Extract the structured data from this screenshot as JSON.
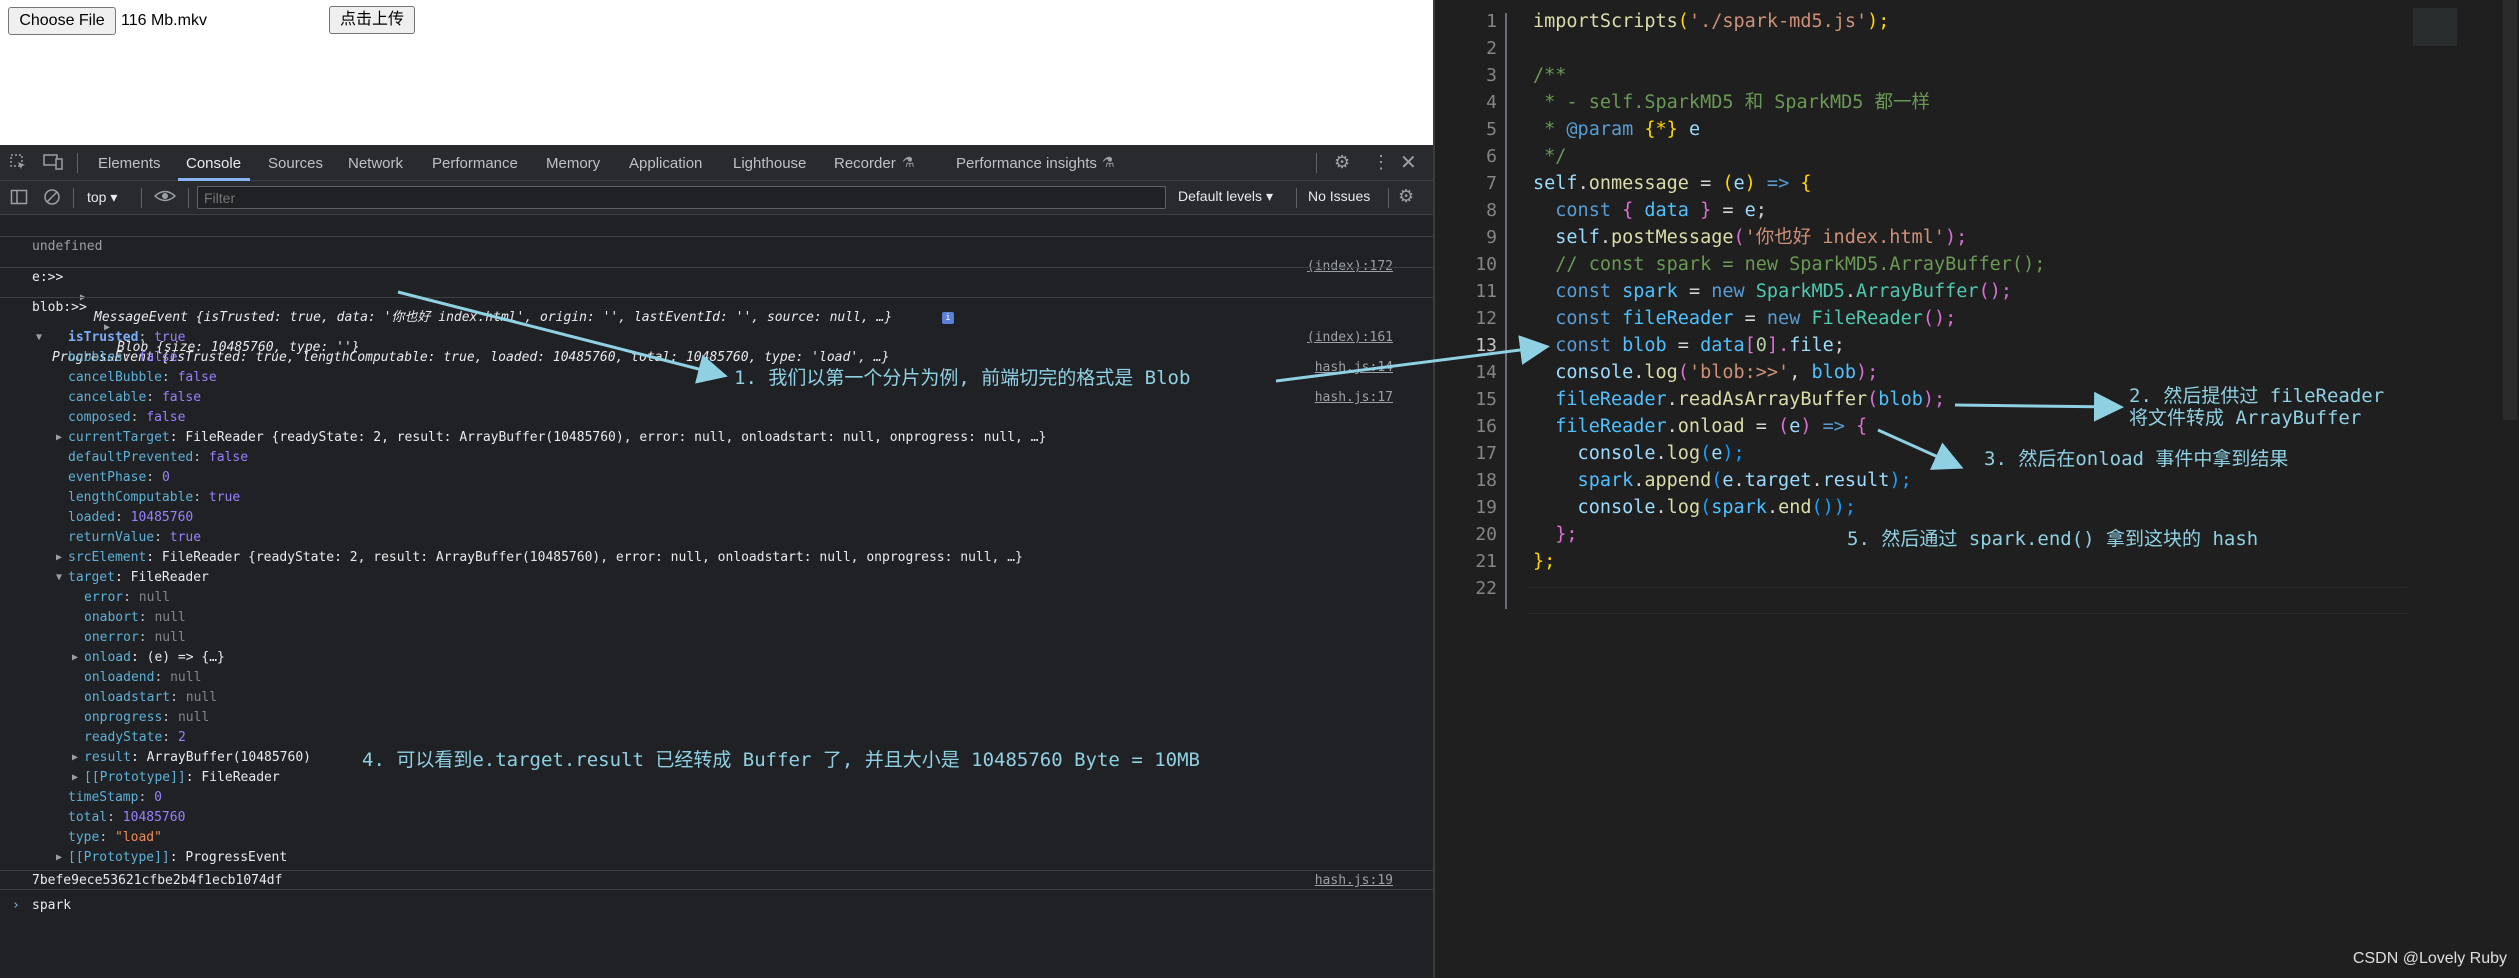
{
  "page": {
    "choose_file_label": "Choose File",
    "file_name": "116 Mb.mkv",
    "upload_label": "点击上传"
  },
  "devtools": {
    "tabs": [
      "Elements",
      "Console",
      "Sources",
      "Network",
      "Performance",
      "Memory",
      "Application",
      "Lighthouse",
      "Recorder",
      "Performance insights"
    ],
    "active_tab": "Console",
    "context": "top",
    "filter_placeholder": "Filter",
    "levels": "Default levels",
    "issues": "No Issues",
    "icons": [
      "inspect-icon",
      "device-icon",
      "gear-icon",
      "more-icon",
      "close-icon",
      "sidebar-icon",
      "clear-icon",
      "eye-icon"
    ]
  },
  "console": {
    "undefined": "undefined",
    "src_index172": "(index):172",
    "src_index161": "(index):161",
    "src_hash14": "hash.js:14",
    "src_hash17": "hash.js:17",
    "src_hash19": "hash.js:19",
    "e_prefix": "e:>> ",
    "e_obj": "MessageEvent {isTrusted: true, data: '你也好 index.html', origin: '', lastEventId: '', source: null, …}",
    "blob_prefix": "blob:>> ",
    "blob_obj": "Blob {size: 10485760, type: ''}",
    "progress_obj": "ProgressEvent {isTrusted: true, lengthComputable: true, loaded: 10485760, total: 10485760, type: 'load', …}",
    "props": [
      [
        "isTrusted",
        "true"
      ],
      [
        "bubbles",
        "false"
      ],
      [
        "cancelBubble",
        "false"
      ],
      [
        "cancelable",
        "false"
      ],
      [
        "composed",
        "false"
      ]
    ],
    "currentTarget": "currentTarget: FileReader {readyState: 2, result: ArrayBuffer(10485760), error: null, onloadstart: null, onprogress: null, …}",
    "props2": [
      [
        "defaultPrevented",
        "false"
      ],
      [
        "eventPhase",
        "0"
      ],
      [
        "lengthComputable",
        "true"
      ],
      [
        "loaded",
        "10485760"
      ],
      [
        "returnValue",
        "true"
      ]
    ],
    "srcElement": "srcElement: FileReader {readyState: 2, result: ArrayBuffer(10485760), error: null, onloadstart: null, onprogress: null, …}",
    "target": "target: FileReader",
    "target_props": [
      [
        "error",
        "null"
      ],
      [
        "onabort",
        "null"
      ],
      [
        "onerror",
        "null"
      ]
    ],
    "onload": "onload: (e) => {…}",
    "target_props2": [
      [
        "onloadend",
        "null"
      ],
      [
        "onloadstart",
        "null"
      ],
      [
        "onprogress",
        "null"
      ],
      [
        "readyState",
        "2"
      ]
    ],
    "result": "result: ArrayBuffer(10485760)",
    "proto_fr": "[[Prototype]]: FileReader",
    "props3": [
      [
        "timeStamp",
        "0"
      ],
      [
        "total",
        "10485760"
      ],
      [
        "type",
        "\"load\""
      ]
    ],
    "proto_pe": "[[Prototype]]: ProgressEvent",
    "hash": "7befe9ece53621cfbe2b4f1ecb1074df",
    "prompt": "spark"
  },
  "annotations": {
    "a1": "1. 我们以第一个分片为例, 前端切完的格式是 Blob",
    "a2_line1": "2. 然后提供过 fileReader",
    "a2_line2": "将文件转成 ArrayBuffer",
    "a3": "3. 然后在onload 事件中拿到结果",
    "a4": "4. 可以看到e.target.result 已经转成 Buffer 了, 并且大小是 10485760 Byte = 10MB",
    "a5": "5. 然后通过 spark.end() 拿到这块的 hash"
  },
  "editor": {
    "line_numbers": [
      "1",
      "2",
      "3",
      "4",
      "5",
      "6",
      "7",
      "8",
      "9",
      "10",
      "11",
      "12",
      "13",
      "14",
      "15",
      "16",
      "17",
      "18",
      "19",
      "20",
      "21",
      "22"
    ],
    "current_line": "13",
    "code": {
      "l1a": "importScripts",
      "l1b": "(",
      "l1c": "'./spark-md5.js'",
      "l1d": ");",
      "l3": "/**",
      "l4": " * - self.SparkMD5 和 SparkMD5 都一样",
      "l5a": " * ",
      "l5b": "@param",
      "l5c": " {*}",
      "l5d": " e",
      "l6": " */",
      "l7a": "self",
      "l7b": ".",
      "l7c": "onmessage",
      "l7d": " = ",
      "l7e": "(",
      "l7f": "e",
      "l7g": ")",
      "l7h": " => ",
      "l7i": "{",
      "l8a": "  const ",
      "l8b": "{ ",
      "l8c": "data",
      "l8d": " }",
      "l8e": " = ",
      "l8f": "e",
      "l8g": ";",
      "l9a": "  self",
      "l9b": ".",
      "l9c": "postMessage",
      "l9d": "(",
      "l9e": "'你也好 index.html'",
      "l9f": ");",
      "l10": "  // const spark = new SparkMD5.ArrayBuffer();",
      "l11a": "  const ",
      "l11b": "spark",
      "l11c": " = ",
      "l11d": "new ",
      "l11e": "SparkMD5",
      "l11f": ".",
      "l11g": "ArrayBuffer",
      "l11h": "();",
      "l12a": "  const ",
      "l12b": "fileReader",
      "l12c": " = ",
      "l12d": "new ",
      "l12e": "FileReader",
      "l12f": "();",
      "l13a": "  const ",
      "l13b": "blob",
      "l13c": " = ",
      "l13d": "data",
      "l13e": "[",
      "l13f": "0",
      "l13g": "].",
      "l13h": "file",
      "l13i": ";",
      "l14a": "  console",
      "l14b": ".",
      "l14c": "log",
      "l14d": "(",
      "l14e": "'blob:>>'",
      "l14f": ", ",
      "l14g": "blob",
      "l14h": ");",
      "l15a": "  fileReader",
      "l15b": ".",
      "l15c": "readAsArrayBuffer",
      "l15d": "(",
      "l15e": "blob",
      "l15f": ");",
      "l16a": "  fileReader",
      "l16b": ".",
      "l16c": "onload",
      "l16d": " = ",
      "l16e": "(",
      "l16f": "e",
      "l16g": ")",
      "l16h": " => ",
      "l16i": "{",
      "l17a": "    console",
      "l17b": ".",
      "l17c": "log",
      "l17d": "(",
      "l17e": "e",
      "l17f": ");",
      "l18a": "    spark",
      "l18b": ".",
      "l18c": "append",
      "l18d": "(",
      "l18e": "e",
      "l18f": ".",
      "l18g": "target",
      "l18h": ".",
      "l18i": "result",
      "l18j": ");",
      "l19a": "    console",
      "l19b": ".",
      "l19c": "log",
      "l19d": "(",
      "l19e": "spark",
      "l19f": ".",
      "l19g": "end",
      "l19h": "());",
      "l20a": "  ",
      "l20b": "};",
      "l21a": "",
      "l21b": "};"
    }
  },
  "watermark": "CSDN @Lovely Ruby",
  "colors": {
    "annotation": "#8fd1e3",
    "devtools_bg": "#202124",
    "editor_bg": "#1f1f1f"
  }
}
